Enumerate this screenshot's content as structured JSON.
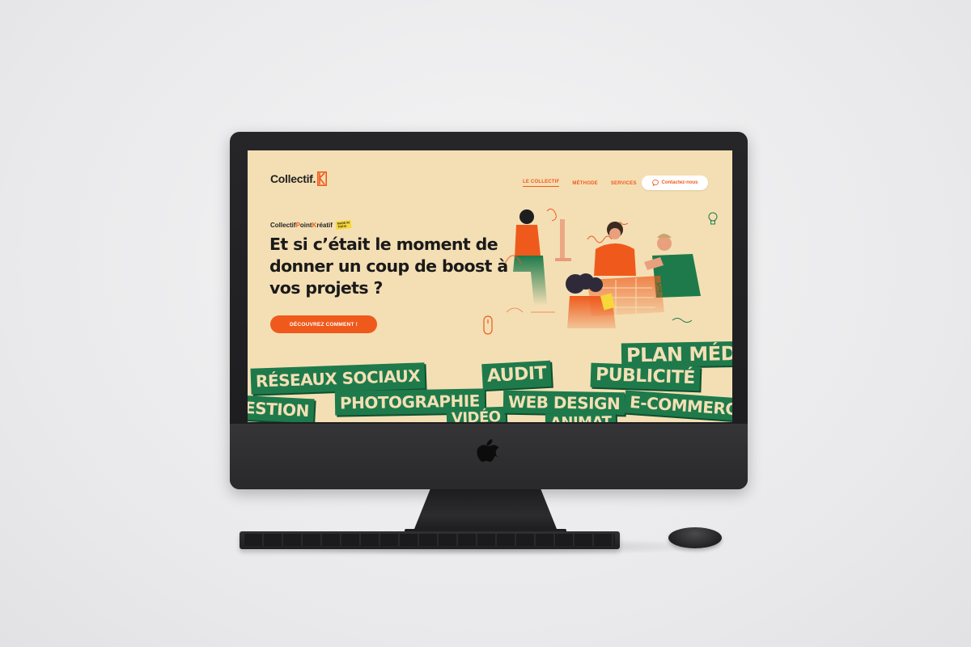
{
  "site": {
    "logo_text": "Collectif.",
    "nav": [
      {
        "label": "LE COLLECTIF"
      },
      {
        "label": "MÉTHODE"
      },
      {
        "label": "SERVICES"
      }
    ],
    "contact_label": "Contactez-nous",
    "tagline": {
      "c": "C",
      "part1": "ollectif ",
      "p": "P",
      "part2": "oint ",
      "k": "K",
      "part3": "réatif",
      "badge": "MADE IN\nTOKIA"
    },
    "headline": "Et si c’était le moment de donner un coup de boost à vos projets ?",
    "cta_label": "DÉCOUVREZ COMMENT !",
    "tags": [
      "RÉSEAUX SOCIAUX",
      "AUDIT",
      "PLAN MÉDIA",
      "PUBLICITÉ",
      "ESTION",
      "PHOTOGRAPHIE",
      "WEB DESIGN",
      "E-COMMERCE",
      "VIDÉO",
      "ANIMAT"
    ]
  },
  "colors": {
    "background": "#f4dfb4",
    "accent": "#ef5a1c",
    "green": "#1e7a4b",
    "text": "#1a1a1a"
  },
  "icons": [
    "apple-logo-icon",
    "speech-bubble-icon",
    "mouse-scroll-icon",
    "lightbulb-icon",
    "star-icon"
  ]
}
